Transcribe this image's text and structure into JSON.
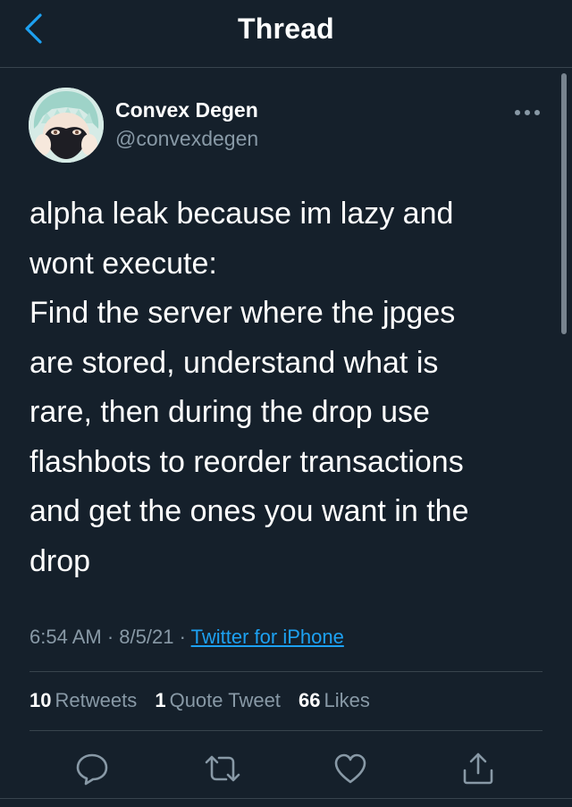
{
  "header": {
    "title": "Thread",
    "back_icon": "chevron-left-icon"
  },
  "colors": {
    "background": "#15202b",
    "accent": "#1da1f2",
    "secondary_text": "#8899a6",
    "divider": "#38444d"
  },
  "tweet": {
    "author_name": "Convex Degen",
    "author_handle": "@convexdegen",
    "more_icon": "more-horizontal-icon",
    "text": "alpha leak because im lazy and\nwont execute:\nFind the server where the jpges\nare stored, understand what is\nrare, then during the drop use\nflashbots to reorder transactions\nand get the ones you want in the\ndrop",
    "time": "6:54 AM",
    "date": "8/5/21",
    "separator": "·",
    "source": "Twitter for iPhone"
  },
  "stats": {
    "retweets_count": "10",
    "retweets_label": "Retweets",
    "quotes_count": "1",
    "quotes_label": "Quote Tweet",
    "likes_count": "66",
    "likes_label": "Likes"
  },
  "actions": {
    "reply_icon": "reply-icon",
    "retweet_icon": "retweet-icon",
    "like_icon": "heart-icon",
    "share_icon": "share-icon"
  }
}
